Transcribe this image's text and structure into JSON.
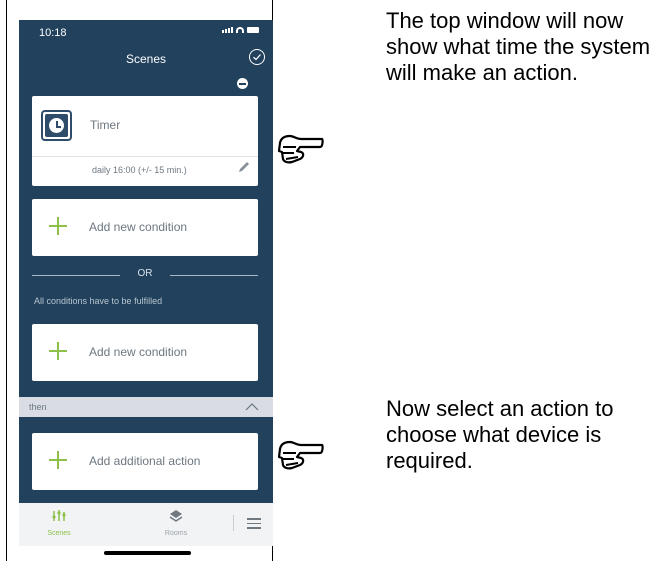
{
  "phone": {
    "status_time": "10:18",
    "title": "Scenes",
    "condition_card": {
      "label": "Timer",
      "schedule": "daily 16:00 (+/- 15 min.)"
    },
    "add_condition_1": "Add new condition",
    "or_label": "OR",
    "all_conditions_note": "All conditions have to be fulfilled",
    "add_condition_2": "Add new condition",
    "then_label": "then",
    "add_action": "Add additional action",
    "tabs": [
      {
        "label": "Scenes",
        "icon": "scenes-icon",
        "active": true
      },
      {
        "label": "Rooms",
        "icon": "rooms-icon",
        "active": false
      }
    ]
  },
  "colors": {
    "background": "#22415c",
    "accent": "#8cc04a",
    "card": "#ffffff",
    "then_bar": "#d9dde3"
  },
  "notes": {
    "top": "The top window will now show what time the system will make an action.",
    "bottom": "Now select an action to choose what device is required."
  },
  "icons": [
    "pointing-hand-icon",
    "pointing-hand-icon"
  ]
}
